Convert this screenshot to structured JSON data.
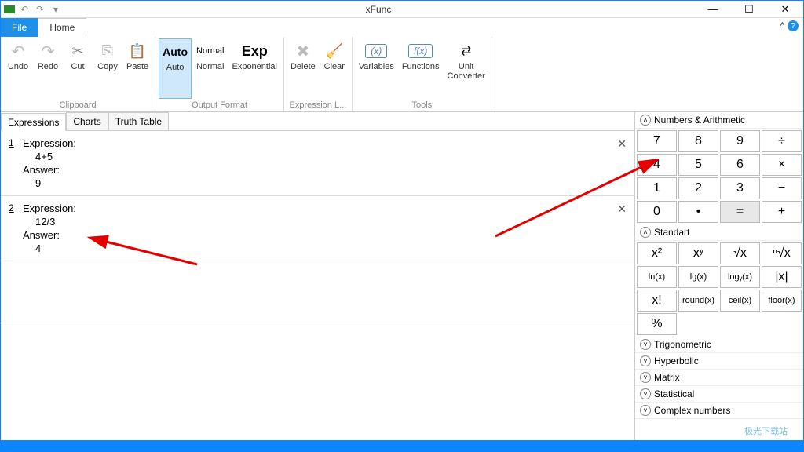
{
  "title": "xFunc",
  "menu": {
    "file": "File",
    "home": "Home"
  },
  "ribbon": {
    "clipboard": {
      "label": "Clipboard",
      "undo": "Undo",
      "redo": "Redo",
      "cut": "Cut",
      "copy": "Copy",
      "paste": "Paste"
    },
    "output": {
      "label": "Output Format",
      "auto_icon": "Auto",
      "auto": "Auto",
      "normal_icon": "Normal",
      "normal": "Normal",
      "exp_icon": "Exp",
      "exp": "Exponential"
    },
    "exprlist": {
      "label": "Expression L...",
      "delete": "Delete",
      "clear": "Clear"
    },
    "tools": {
      "label": "Tools",
      "variables": "Variables",
      "functions": "Functions",
      "unit_converter": "Unit\nConverter",
      "var_icon": "(x)",
      "func_icon": "f(x)"
    }
  },
  "subtabs": {
    "expressions": "Expressions",
    "charts": "Charts",
    "truth": "Truth Table"
  },
  "labels": {
    "expression": "Expression:",
    "answer": "Answer:"
  },
  "items": [
    {
      "n": "1",
      "expr": "4+5",
      "ans": "9"
    },
    {
      "n": "2",
      "expr": "12/3",
      "ans": "4"
    }
  ],
  "side": {
    "numbers_title": "Numbers & Arithmetic",
    "numbers": [
      "7",
      "8",
      "9",
      "÷",
      "4",
      "5",
      "6",
      "×",
      "1",
      "2",
      "3",
      "−",
      "0",
      "•",
      "=",
      "+"
    ],
    "standart_title": "Standart",
    "standart": [
      "x²",
      "xʸ",
      "√x",
      "ⁿ√x",
      "ln(x)",
      "lg(x)",
      "logᵧ(x)",
      "|x|",
      "x!",
      "round(x)",
      "ceil(x)",
      "floor(x)",
      "%"
    ],
    "trig": "Trigonometric",
    "hyper": "Hyperbolic",
    "matrix": "Matrix",
    "stat": "Statistical",
    "complex": "Complex numbers"
  },
  "watermark": "极光下载站"
}
